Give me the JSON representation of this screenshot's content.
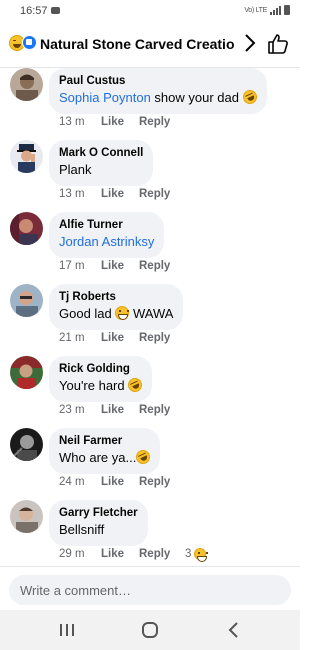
{
  "status_bar": {
    "time": "16:57",
    "network": "Vo) LTE"
  },
  "header": {
    "title": "Natural Stone Carved Creation..."
  },
  "comments": [
    {
      "name": "Paul Custus",
      "tag": "Sophia Poynton",
      "text": " show your dad ",
      "emoji": "rofl",
      "time": "13 m",
      "like": "Like",
      "reply": "Reply"
    },
    {
      "name": "Mark O Connell",
      "tag": "",
      "text": "Plank",
      "emoji": "",
      "time": "13 m",
      "like": "Like",
      "reply": "Reply"
    },
    {
      "name": "Alfie Turner",
      "tag": "Jordan Astrinksy",
      "text": "",
      "emoji": "",
      "time": "17 m",
      "like": "Like",
      "reply": "Reply"
    },
    {
      "name": "Tj Roberts",
      "tag": "",
      "text": "Good lad ",
      "emoji": "grin",
      "text_after": " WAWA",
      "time": "21 m",
      "like": "Like",
      "reply": "Reply"
    },
    {
      "name": "Rick Golding",
      "tag": "",
      "text": "You're hard ",
      "emoji": "rofl",
      "time": "23 m",
      "like": "Like",
      "reply": "Reply"
    },
    {
      "name": "Neil Farmer",
      "tag": "",
      "text": "Who are ya...",
      "emoji": "rofl",
      "time": "24 m",
      "like": "Like",
      "reply": "Reply"
    },
    {
      "name": "Garry Fletcher",
      "tag": "",
      "text": "Bellsniff",
      "emoji": "",
      "time": "29 m",
      "like": "Like",
      "reply": "Reply",
      "reaction_count": "3"
    }
  ],
  "composer": {
    "placeholder": "Write a comment…"
  },
  "colors": {
    "bubble": "#f0f2f5",
    "tag": "#216fdb",
    "meta": "#65676b",
    "accent": "#1877f2"
  },
  "icons": [
    "emoji-icon",
    "like-badge-icon",
    "chevron-right-icon",
    "thumbs-up-icon",
    "recent-apps-icon",
    "home-icon",
    "back-icon"
  ]
}
